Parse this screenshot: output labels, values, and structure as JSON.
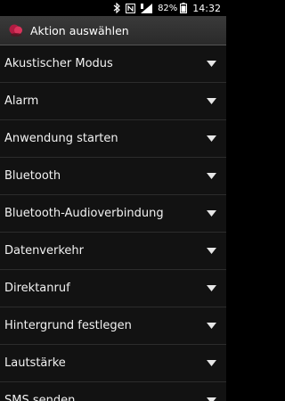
{
  "status_bar": {
    "battery_percent": "82%",
    "time": "14:32",
    "icons": [
      "bluetooth-icon",
      "nfc-icon",
      "signal-icon",
      "battery-icon"
    ]
  },
  "title_bar": {
    "title": "Aktion auswählen",
    "app_icon": "app-icon"
  },
  "list": {
    "items": [
      {
        "label": "Akustischer Modus",
        "icon": "chevron-down-icon"
      },
      {
        "label": "Alarm",
        "icon": "chevron-down-icon"
      },
      {
        "label": "Anwendung starten",
        "icon": "chevron-down-icon"
      },
      {
        "label": "Bluetooth",
        "icon": "chevron-down-icon"
      },
      {
        "label": "Bluetooth-Audioverbindung",
        "icon": "chevron-down-icon"
      },
      {
        "label": "Datenverkehr",
        "icon": "chevron-down-icon"
      },
      {
        "label": "Direktanruf",
        "icon": "chevron-down-icon"
      },
      {
        "label": "Hintergrund festlegen",
        "icon": "chevron-down-icon"
      },
      {
        "label": "Lautstärke",
        "icon": "chevron-down-icon"
      },
      {
        "label": "SMS senden",
        "icon": "chevron-down-icon"
      }
    ]
  },
  "colors": {
    "background": "#121212",
    "title_bar": "#333333",
    "text": "#f2f2f2",
    "divider": "#2c2c2c",
    "app_icon_accent": "#c8204a"
  }
}
